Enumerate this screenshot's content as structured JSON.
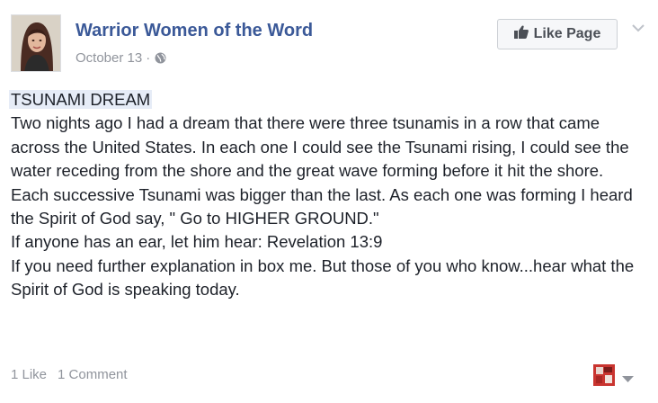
{
  "post": {
    "page_name": "Warrior Women of the Word",
    "date": "October 13",
    "separator": "·",
    "privacy_icon": "globe-icon",
    "like_page_label": "Like Page",
    "menu_icon": "chevron-down-icon",
    "headline": "TSUNAMI DREAM",
    "paragraphs": [
      "Two nights ago I had a dream that there were three tsunamis in a row that came across the United States. In each one I could see the Tsunami rising, I could see the water receding from the shore and the great wave forming before it hit the shore. Each successive Tsunami was bigger than the last. As each one was forming I heard the Spirit of God say, \" Go to HIGHER GROUND.\"",
      "If anyone has an ear, let him hear: Revelation 13:9",
      "If you need further explanation in box me. But those of you who know...hear what the Spirit of God is speaking today."
    ]
  },
  "footer": {
    "likes": "1 Like",
    "comments": "1 Comment",
    "actor_avatar_icon": "avatar",
    "actor_menu_icon": "caret-down-icon"
  },
  "colors": {
    "link": "#3b5998",
    "meta": "#90949c",
    "text": "#1d2129",
    "highlight": "#e6ecf7"
  }
}
